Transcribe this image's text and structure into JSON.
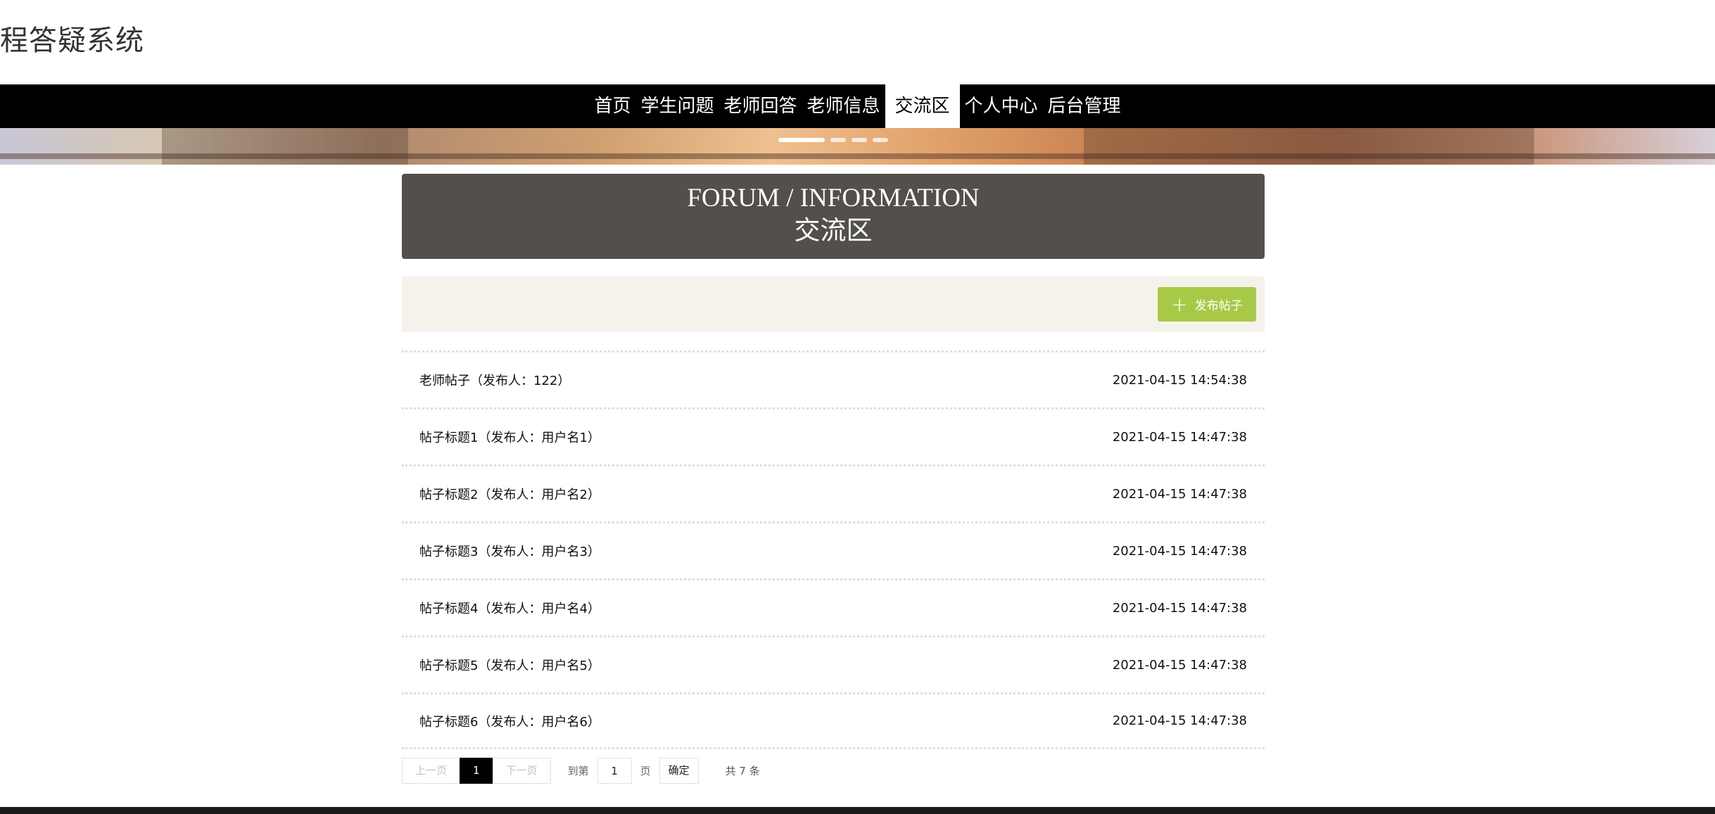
{
  "site": {
    "title": "程答疑系统"
  },
  "nav": {
    "items": [
      {
        "label": "首页"
      },
      {
        "label": "学生问题"
      },
      {
        "label": "老师回答"
      },
      {
        "label": "老师信息"
      },
      {
        "label": "交流区"
      },
      {
        "label": "个人中心"
      },
      {
        "label": "后台管理"
      }
    ],
    "active_index": 4
  },
  "banner": {
    "slide_count": 4,
    "active_slide": 1
  },
  "header": {
    "en_title": "FORUM / INFORMATION",
    "zh_title": "交流区"
  },
  "toolbar": {
    "post_button_label": "发布帖子",
    "post_button_color": "#a8c948"
  },
  "posts": [
    {
      "title": "老师帖子（发布人：122）",
      "time": "2021-04-15 14:54:38"
    },
    {
      "title": "帖子标题1（发布人：用户名1）",
      "time": "2021-04-15 14:47:38"
    },
    {
      "title": "帖子标题2（发布人：用户名2）",
      "time": "2021-04-15 14:47:38"
    },
    {
      "title": "帖子标题3（发布人：用户名3）",
      "time": "2021-04-15 14:47:38"
    },
    {
      "title": "帖子标题4（发布人：用户名4）",
      "time": "2021-04-15 14:47:38"
    },
    {
      "title": "帖子标题5（发布人：用户名5）",
      "time": "2021-04-15 14:47:38"
    },
    {
      "title": "帖子标题6（发布人：用户名6）",
      "time": "2021-04-15 14:47:38"
    }
  ],
  "pager": {
    "prev_label": "上一页",
    "current_page": "1",
    "next_label": "下一页",
    "goto_label": "到第",
    "goto_value": "1",
    "page_label": "页",
    "confirm_label": "确定",
    "total_text": "共 7 条"
  },
  "colors": {
    "nav_bg": "#000000",
    "header_bg": "#524f4d",
    "toolbar_bg": "#f5f2ec"
  }
}
